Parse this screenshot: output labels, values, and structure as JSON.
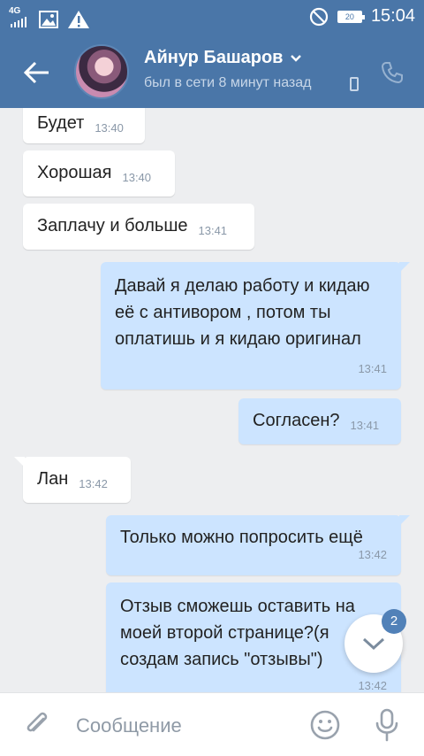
{
  "status_bar": {
    "network": "4G",
    "battery": "20",
    "time": "15:04"
  },
  "header": {
    "contact_name": "Айнур Башаров",
    "last_seen": "был в сети 8 минут назад"
  },
  "messages": [
    {
      "direction": "in",
      "text": "Будет",
      "time": "13:40"
    },
    {
      "direction": "in",
      "text": "Хорошая",
      "time": "13:40"
    },
    {
      "direction": "in",
      "text": "Заплачу и больше",
      "time": "13:41"
    },
    {
      "direction": "out",
      "text": "Давай я делаю работу и кидаю её с антивором , потом ты оплатишь и я кидаю оригинал",
      "time": "13:41"
    },
    {
      "direction": "out",
      "text": "Согласен?",
      "time": "13:41"
    },
    {
      "direction": "in",
      "text": "Лан",
      "time": "13:42"
    },
    {
      "direction": "out",
      "text": "Только можно попросить ещё",
      "time": "13:42"
    },
    {
      "direction": "out",
      "text": "Отзыв сможешь оставить на моей второй странице?(я создам запись \"отзывы\")",
      "time": "13:42"
    }
  ],
  "scroll_down": {
    "unread_count": "2"
  },
  "composer": {
    "placeholder": "Сообщение"
  },
  "colors": {
    "header": "#4a76a8",
    "incoming_bubble": "#ffffff",
    "outgoing_bubble": "#cce4ff",
    "chat_background": "#edeef0",
    "accent": "#5181b8"
  },
  "icons": {
    "back": "arrow-left-icon",
    "dropdown": "chevron-down-icon",
    "mobile": "mobile-phone-icon",
    "call": "phone-icon",
    "attach": "paperclip-icon",
    "emoji": "smiley-icon",
    "mic": "microphone-icon",
    "scroll_down": "chevron-down-icon"
  }
}
